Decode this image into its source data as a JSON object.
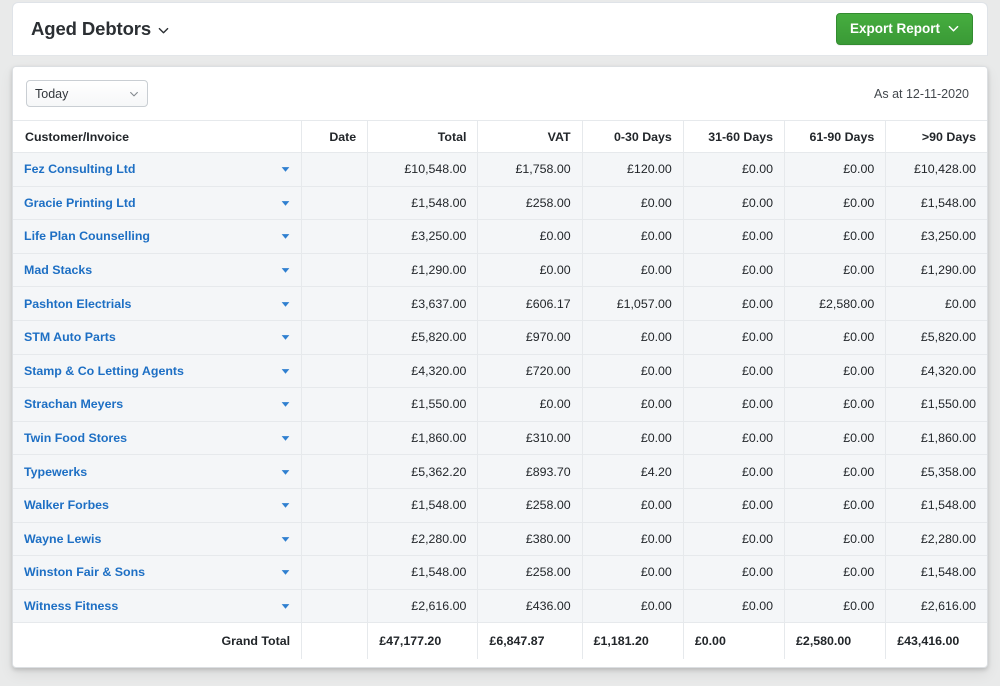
{
  "header": {
    "title": "Aged Debtors",
    "title_caret_icon": "chevron-down-icon",
    "export_label": "Export Report",
    "export_caret_icon": "chevron-down-icon",
    "accent_green": "#3a9a36",
    "link_blue": "#1d6fc4"
  },
  "filters": {
    "period_value": "Today",
    "period_caret_icon": "chevron-down-icon",
    "as_at": "As at 12-11-2020"
  },
  "table": {
    "columns": [
      "Customer/Invoice",
      "Date",
      "Total",
      "VAT",
      "0-30 Days",
      "31-60 Days",
      "61-90 Days",
      ">90 Days"
    ],
    "rows": [
      {
        "customer": "Fez Consulting Ltd",
        "date": "",
        "total": "£10,548.00",
        "vat": "£1,758.00",
        "d0_30": "£120.00",
        "d31_60": "£0.00",
        "d61_90": "£0.00",
        "d90plus": "£10,428.00"
      },
      {
        "customer": "Gracie Printing Ltd",
        "date": "",
        "total": "£1,548.00",
        "vat": "£258.00",
        "d0_30": "£0.00",
        "d31_60": "£0.00",
        "d61_90": "£0.00",
        "d90plus": "£1,548.00"
      },
      {
        "customer": "Life Plan Counselling",
        "date": "",
        "total": "£3,250.00",
        "vat": "£0.00",
        "d0_30": "£0.00",
        "d31_60": "£0.00",
        "d61_90": "£0.00",
        "d90plus": "£3,250.00"
      },
      {
        "customer": "Mad Stacks",
        "date": "",
        "total": "£1,290.00",
        "vat": "£0.00",
        "d0_30": "£0.00",
        "d31_60": "£0.00",
        "d61_90": "£0.00",
        "d90plus": "£1,290.00"
      },
      {
        "customer": "Pashton Electrials",
        "date": "",
        "total": "£3,637.00",
        "vat": "£606.17",
        "d0_30": "£1,057.00",
        "d31_60": "£0.00",
        "d61_90": "£2,580.00",
        "d90plus": "£0.00"
      },
      {
        "customer": "STM Auto Parts",
        "date": "",
        "total": "£5,820.00",
        "vat": "£970.00",
        "d0_30": "£0.00",
        "d31_60": "£0.00",
        "d61_90": "£0.00",
        "d90plus": "£5,820.00"
      },
      {
        "customer": "Stamp & Co Letting Agents",
        "date": "",
        "total": "£4,320.00",
        "vat": "£720.00",
        "d0_30": "£0.00",
        "d31_60": "£0.00",
        "d61_90": "£0.00",
        "d90plus": "£4,320.00"
      },
      {
        "customer": "Strachan Meyers",
        "date": "",
        "total": "£1,550.00",
        "vat": "£0.00",
        "d0_30": "£0.00",
        "d31_60": "£0.00",
        "d61_90": "£0.00",
        "d90plus": "£1,550.00"
      },
      {
        "customer": "Twin Food Stores",
        "date": "",
        "total": "£1,860.00",
        "vat": "£310.00",
        "d0_30": "£0.00",
        "d31_60": "£0.00",
        "d61_90": "£0.00",
        "d90plus": "£1,860.00"
      },
      {
        "customer": "Typewerks",
        "date": "",
        "total": "£5,362.20",
        "vat": "£893.70",
        "d0_30": "£4.20",
        "d31_60": "£0.00",
        "d61_90": "£0.00",
        "d90plus": "£5,358.00"
      },
      {
        "customer": "Walker Forbes",
        "date": "",
        "total": "£1,548.00",
        "vat": "£258.00",
        "d0_30": "£0.00",
        "d31_60": "£0.00",
        "d61_90": "£0.00",
        "d90plus": "£1,548.00"
      },
      {
        "customer": "Wayne Lewis",
        "date": "",
        "total": "£2,280.00",
        "vat": "£380.00",
        "d0_30": "£0.00",
        "d31_60": "£0.00",
        "d61_90": "£0.00",
        "d90plus": "£2,280.00"
      },
      {
        "customer": "Winston Fair & Sons",
        "date": "",
        "total": "£1,548.00",
        "vat": "£258.00",
        "d0_30": "£0.00",
        "d31_60": "£0.00",
        "d61_90": "£0.00",
        "d90plus": "£1,548.00"
      },
      {
        "customer": "Witness Fitness",
        "date": "",
        "total": "£2,616.00",
        "vat": "£436.00",
        "d0_30": "£0.00",
        "d31_60": "£0.00",
        "d61_90": "£0.00",
        "d90plus": "£2,616.00"
      }
    ],
    "row_caret_icon": "caret-down-icon",
    "grand_total": {
      "label": "Grand Total",
      "total": "£47,177.20",
      "vat": "£6,847.87",
      "d0_30": "£1,181.20",
      "d31_60": "£0.00",
      "d61_90": "£2,580.00",
      "d90plus": "£43,416.00"
    }
  }
}
